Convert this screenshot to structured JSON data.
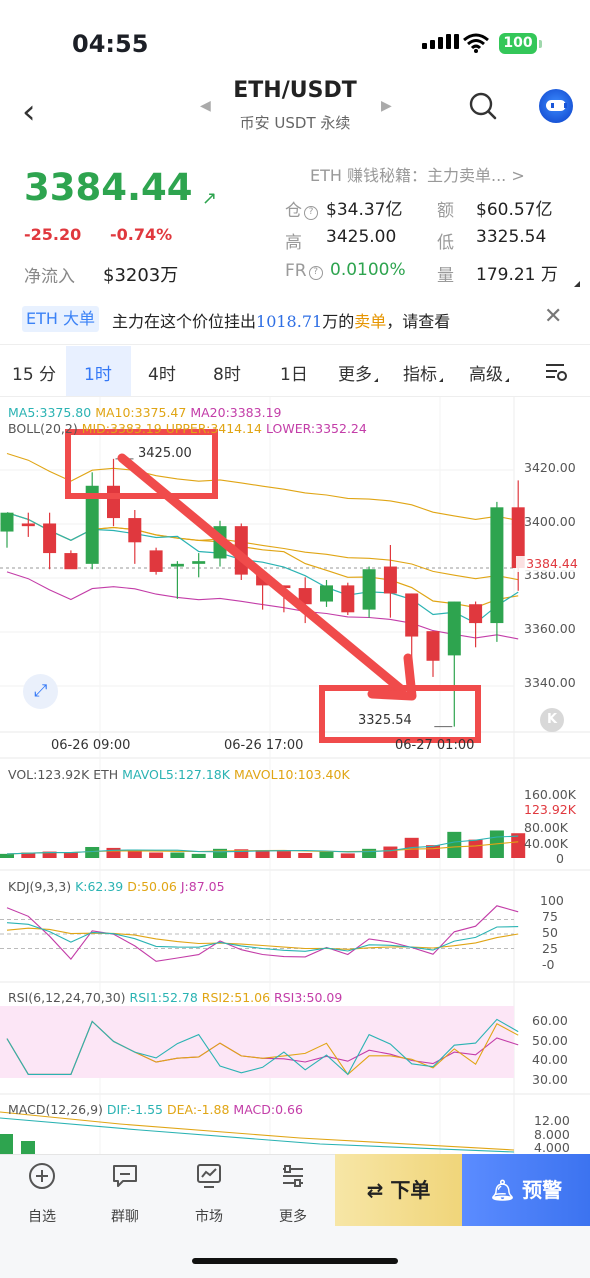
{
  "status": {
    "time": "04:55",
    "battery": "100"
  },
  "header": {
    "pair": "ETH/USDT",
    "subtitle": "币安 USDT 永续"
  },
  "price": {
    "last": "3384.44",
    "change": "-25.20",
    "change_pct": "-0.74%",
    "net_inflow_label": "净流入",
    "net_inflow": "$3203万"
  },
  "tip": "ETH 赚钱秘籍：主力卖单... >",
  "stats": {
    "oi_label": "仓",
    "oi": "$34.37亿",
    "amount_label": "额",
    "amount": "$60.57亿",
    "high_label": "高",
    "high": "3425.00",
    "low_label": "低",
    "low": "3325.54",
    "fr_label": "FR",
    "fr": "0.0100%",
    "vol_label": "量",
    "vol": "179.21 万"
  },
  "banner": {
    "tag": "ETH 大单",
    "text_a": "主力在这个价位挂出",
    "amount": "1018.71",
    "text_b": "万的",
    "sell": "卖单",
    "text_c": "，请查看"
  },
  "tabs": [
    "15 分",
    "1时",
    "4时",
    "8时",
    "1日",
    "更多",
    "指标",
    "高级"
  ],
  "active_tab": "1时",
  "indicators": {
    "ma5": "MA5:3375.80",
    "ma10": "MA10:3375.47",
    "ma20": "MA20:3383.19",
    "boll": "BOLL(20,2)",
    "mid": "MID:3383.19",
    "upper": "UPPER:3414.14",
    "lower": "LOWER:3352.24"
  },
  "price_axis": [
    "3420.00",
    "3400.00",
    "3380.00",
    "3360.00",
    "3340.00"
  ],
  "current_price_tag": "3384.44",
  "high_tag": "3425.00",
  "low_tag": "3325.54",
  "x_labels": [
    "06-26 09:00",
    "06-26 17:00",
    "06-27 01:00"
  ],
  "volume": {
    "title": "VOL:123.92K ETH",
    "mavol5": "MAVOL5:127.18K",
    "mavol10": "MAVOL10:103.40K",
    "axis": [
      "160.00K",
      "123.92K",
      "80.00K",
      "40.00K",
      "0"
    ]
  },
  "kdj": {
    "title": "KDJ(9,3,3)",
    "k": "K:62.39",
    "d": "D:50.06",
    "j": "J:87.05",
    "axis": [
      "100",
      "75",
      "50",
      "25",
      "-0"
    ]
  },
  "rsi": {
    "title": "RSI(6,12,24,70,30)",
    "rsi1": "RSI1:52.78",
    "rsi2": "RSI2:51.06",
    "rsi3": "RSI3:50.09",
    "axis": [
      "60.00",
      "50.00",
      "40.00",
      "30.00"
    ]
  },
  "macd": {
    "title": "MACD(12,26,9)",
    "dif": "DIF:-1.55",
    "dea": "DEA:-1.88",
    "macd": "MACD:0.66",
    "axis": [
      "12.00",
      "8.000",
      "4.000"
    ]
  },
  "nav": {
    "watchlist": "自选",
    "chat": "群聊",
    "market": "市场",
    "more": "更多",
    "order": "下单",
    "alert": "预警"
  },
  "colors": {
    "up": "#2ea44f",
    "down": "#e0383e",
    "accent": "#3478f6",
    "annotation": "#f04b4b"
  },
  "chart_data": {
    "type": "candlestick",
    "interval": "1时",
    "candles": [
      {
        "o": 3398,
        "h": 3404,
        "l": 3392,
        "c": 3405
      },
      {
        "o": 3401,
        "h": 3405,
        "l": 3396,
        "c": 3400
      },
      {
        "o": 3401,
        "h": 3405,
        "l": 3384,
        "c": 3390
      },
      {
        "o": 3390,
        "h": 3391,
        "l": 3385,
        "c": 3384
      },
      {
        "o": 3386,
        "h": 3420,
        "l": 3384,
        "c": 3415
      },
      {
        "o": 3415,
        "h": 3425,
        "l": 3400,
        "c": 3403
      },
      {
        "o": 3403,
        "h": 3406,
        "l": 3386,
        "c": 3394
      },
      {
        "o": 3391,
        "h": 3392,
        "l": 3382,
        "c": 3383
      },
      {
        "o": 3385,
        "h": 3387,
        "l": 3373,
        "c": 3386
      },
      {
        "o": 3386,
        "h": 3390,
        "l": 3381,
        "c": 3387
      },
      {
        "o": 3388,
        "h": 3402,
        "l": 3385,
        "c": 3400
      },
      {
        "o": 3400,
        "h": 3401,
        "l": 3380,
        "c": 3382
      },
      {
        "o": 3382,
        "h": 3384,
        "l": 3369,
        "c": 3378
      },
      {
        "o": 3378,
        "h": 3378,
        "l": 3368,
        "c": 3377
      },
      {
        "o": 3377,
        "h": 3381,
        "l": 3364,
        "c": 3371
      },
      {
        "o": 3372,
        "h": 3380,
        "l": 3370,
        "c": 3378
      },
      {
        "o": 3378,
        "h": 3379,
        "l": 3367,
        "c": 3368
      },
      {
        "o": 3369,
        "h": 3385,
        "l": 3366,
        "c": 3384
      },
      {
        "o": 3385,
        "h": 3393,
        "l": 3366,
        "c": 3375
      },
      {
        "o": 3375,
        "h": 3375,
        "l": 3348,
        "c": 3359
      },
      {
        "o": 3361,
        "h": 3361,
        "l": 3344,
        "c": 3350
      },
      {
        "o": 3352,
        "h": 3372,
        "l": 3325.54,
        "c": 3372
      },
      {
        "o": 3371,
        "h": 3372,
        "l": 3355,
        "c": 3364
      },
      {
        "o": 3364,
        "h": 3409,
        "l": 3357,
        "c": 3407
      },
      {
        "o": 3407,
        "h": 3417,
        "l": 3376,
        "c": 3384.44
      }
    ],
    "volume": [
      9,
      12,
      14,
      12,
      24,
      22,
      15,
      12,
      12,
      9,
      20,
      19,
      17,
      15,
      11,
      14,
      10,
      20,
      25,
      44,
      28,
      57,
      40,
      60,
      54
    ],
    "price_range": [
      3328,
      3432
    ],
    "volume_range": [
      0,
      170
    ]
  }
}
